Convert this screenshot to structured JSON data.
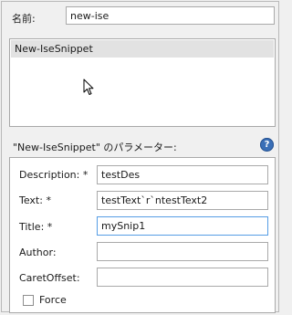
{
  "name_field": {
    "label": "名前:",
    "value": "new-ise"
  },
  "command_list": {
    "items": [
      "New-IseSnippet"
    ]
  },
  "parameters": {
    "title": "\"New-IseSnippet\" のパラメーター:",
    "help_glyph": "?",
    "rows": [
      {
        "label": "Description: *",
        "value": "testDes"
      },
      {
        "label": "Text: *",
        "value": "testText`r`ntestText2"
      },
      {
        "label": "Title: *",
        "value": "mySnip1"
      },
      {
        "label": "Author:",
        "value": ""
      },
      {
        "label": "CaretOffset:",
        "value": ""
      }
    ],
    "force_label": "Force"
  }
}
